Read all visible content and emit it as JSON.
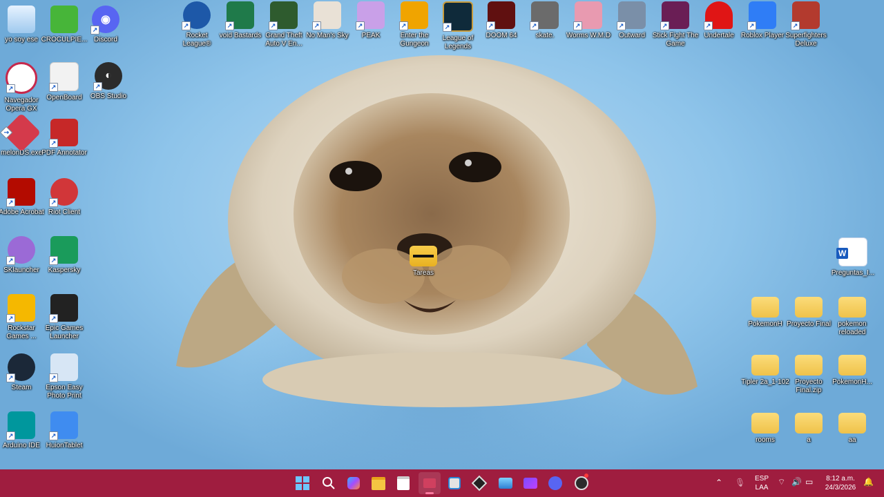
{
  "desktop": {
    "left_column_1": [
      {
        "label": "yo soy ese",
        "icon": "recycle-bin-icon"
      },
      {
        "label": "Navegador Opera GX",
        "icon": "opera-gx-icon"
      },
      {
        "label": "melonDS.exe",
        "icon": "melonds-icon"
      },
      {
        "label": "Adobe Acrobat",
        "icon": "adobe-acrobat-icon"
      },
      {
        "label": "SKlauncher",
        "icon": "sklauncher-icon"
      },
      {
        "label": "Rockstar Games ...",
        "icon": "rockstar-icon"
      },
      {
        "label": "Steam",
        "icon": "steam-icon"
      },
      {
        "label": "Arduino IDE",
        "icon": "arduino-icon"
      }
    ],
    "left_column_2": [
      {
        "label": "CROCULPIE...",
        "icon": "croc-icon"
      },
      {
        "label": "OpenBoard",
        "icon": "openboard-icon"
      },
      {
        "label": "PDF Annotator",
        "icon": "pdf-annotator-icon"
      },
      {
        "label": "Riot Client",
        "icon": "riot-client-icon"
      },
      {
        "label": "Kaspersky",
        "icon": "kaspersky-icon"
      },
      {
        "label": "Epic Games Launcher",
        "icon": "epic-games-icon"
      },
      {
        "label": "Epson Easy Photo Print",
        "icon": "epson-icon"
      },
      {
        "label": "HuionTablet",
        "icon": "huion-icon"
      }
    ],
    "discord": {
      "label": "Discord",
      "icon": "discord-icon"
    },
    "obs": {
      "label": "OBS Studio",
      "icon": "obs-icon"
    },
    "top_row": [
      {
        "label": "Rocket League®",
        "icon": "rocket-league-icon"
      },
      {
        "label": "void Bastards",
        "icon": "void-bastards-icon"
      },
      {
        "label": "Grand Theft Auto V En...",
        "icon": "gta-v-icon"
      },
      {
        "label": "No Man's Sky",
        "icon": "no-mans-sky-icon"
      },
      {
        "label": "PEAK",
        "icon": "peak-icon"
      },
      {
        "label": "Enter the Gungeon",
        "icon": "enter-the-gungeon-icon"
      },
      {
        "label": "League of Legends",
        "icon": "league-of-legends-icon"
      },
      {
        "label": "DOOM 64",
        "icon": "doom-64-icon"
      },
      {
        "label": "skate.",
        "icon": "skate-icon"
      },
      {
        "label": "Worms W.M.D",
        "icon": "worms-icon"
      },
      {
        "label": "Outward",
        "icon": "outward-icon"
      },
      {
        "label": "Stick Fight The Game",
        "icon": "stick-fight-icon"
      },
      {
        "label": "Undertale",
        "icon": "undertale-icon"
      },
      {
        "label": "Roblox Player",
        "icon": "roblox-icon"
      },
      {
        "label": "Superfighters Deluxe",
        "icon": "superfighters-icon"
      }
    ],
    "center": {
      "label": "Tareas",
      "icon": "folder-icon"
    },
    "right_word": {
      "label": "Preguntas_I...",
      "icon": "word-doc-icon"
    },
    "right_grid": [
      {
        "label": "PokemonH",
        "icon": "folder-icon"
      },
      {
        "label": "Proyecto Final",
        "icon": "folder-icon"
      },
      {
        "label": "pokemon reloaded",
        "icon": "folder-icon"
      },
      {
        "label": "Tipler 2a_1-102",
        "icon": "folder-icon"
      },
      {
        "label": "Proyecto Final.zip",
        "icon": "zip-folder-icon"
      },
      {
        "label": "PokemonH...",
        "icon": "zip-folder-icon"
      },
      {
        "label": "rooms",
        "icon": "folder-icon"
      },
      {
        "label": "a",
        "icon": "folder-icon"
      },
      {
        "label": "aa",
        "icon": "folder-icon"
      }
    ]
  },
  "taskbar": {
    "language": "ESP",
    "region": "LAA",
    "time": "8:12 a.m.",
    "date": "24/3/2026",
    "color": "#9f1d3f"
  }
}
